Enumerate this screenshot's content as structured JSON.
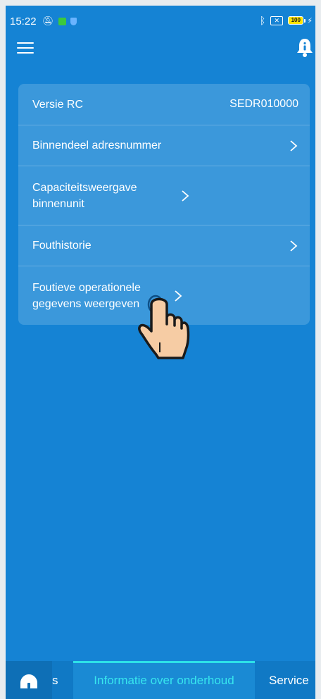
{
  "status_bar": {
    "time": "15:22",
    "battery_level": "100",
    "icons": [
      "mute-icon",
      "green-app-icon",
      "shield-icon",
      "bluetooth-icon",
      "sim-x-icon",
      "battery-icon",
      "charging-icon"
    ]
  },
  "app_bar": {
    "menu_icon": "hamburger-menu-icon",
    "notification_icon": "bell-icon"
  },
  "menu_list": {
    "items": [
      {
        "label": "Versie RC",
        "value": "SEDR010000"
      },
      {
        "label": "Binnendeel adresnummer"
      },
      {
        "label": "Capaciteitsweergave binnenunit"
      },
      {
        "label": "Fouthistorie"
      },
      {
        "label": "Foutieve operationele gegevens weergeven"
      }
    ]
  },
  "tabs": {
    "home_icon": "home-icon",
    "partial_label": "s",
    "active_label": "Informatie over onderhoud",
    "service_label": "Service"
  },
  "colors": {
    "background": "#1583d4",
    "card": "#3b98db",
    "active_tab_text": "#37e6ee",
    "active_tab_indicator": "#2de0e8"
  }
}
